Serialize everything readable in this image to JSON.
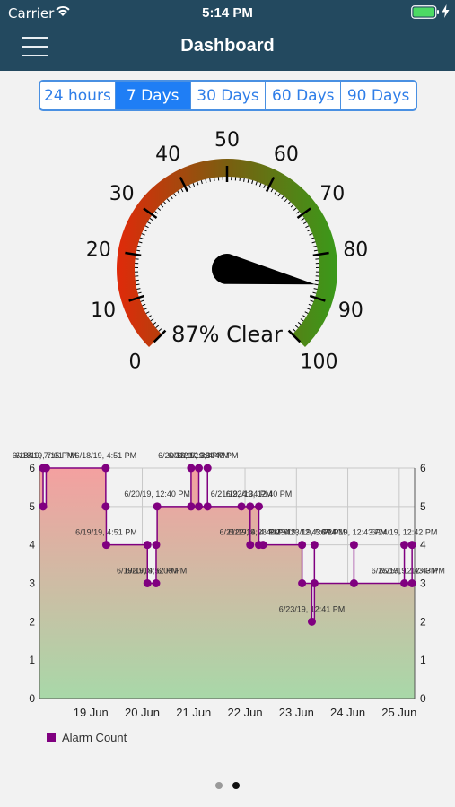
{
  "status_bar": {
    "carrier": "Carrier",
    "time": "5:14 PM"
  },
  "header": {
    "title": "Dashboard"
  },
  "range_tabs": [
    {
      "label": "24 hours",
      "active": false
    },
    {
      "label": "7 Days",
      "active": true
    },
    {
      "label": "30 Days",
      "active": false
    },
    {
      "label": "60 Days",
      "active": false
    },
    {
      "label": "90 Days",
      "active": false
    }
  ],
  "gauge": {
    "value": 87,
    "caption": "87% Clear",
    "min": 0,
    "max": 100,
    "major_labels": [
      "0",
      "10",
      "20",
      "30",
      "40",
      "50",
      "60",
      "70",
      "80",
      "90",
      "100"
    ],
    "gradient": [
      "#e02a0a",
      "#7a5e10",
      "#3a9a1a"
    ]
  },
  "chart_data": {
    "type": "line",
    "xlabels": [
      "19 Jun",
      "20 Jun",
      "21 Jun",
      "22 Jun",
      "23 Jun",
      "24 Jun",
      "25 Jun"
    ],
    "ylim": [
      0,
      6
    ],
    "yticks": [
      "0",
      "1",
      "2",
      "3",
      "4",
      "5",
      "6"
    ],
    "step": true,
    "grid": true,
    "legend": "bottom-left",
    "series": [
      {
        "name": "Alarm Count",
        "color": "#800080",
        "points": [
          {
            "x": 18.07,
            "y": 6
          },
          {
            "x": 18.07,
            "y": 5
          },
          {
            "x": 18.13,
            "y": 6
          },
          {
            "x": 19.29,
            "y": 6
          },
          {
            "x": 19.29,
            "y": 5
          },
          {
            "x": 19.3,
            "y": 4
          },
          {
            "x": 20.1,
            "y": 4
          },
          {
            "x": 20.1,
            "y": 3
          },
          {
            "x": 20.27,
            "y": 3
          },
          {
            "x": 20.27,
            "y": 4
          },
          {
            "x": 20.29,
            "y": 5
          },
          {
            "x": 20.95,
            "y": 5
          },
          {
            "x": 20.95,
            "y": 6
          },
          {
            "x": 21.1,
            "y": 6
          },
          {
            "x": 21.1,
            "y": 5
          },
          {
            "x": 21.27,
            "y": 6
          },
          {
            "x": 21.27,
            "y": 5
          },
          {
            "x": 21.93,
            "y": 5
          },
          {
            "x": 22.1,
            "y": 4
          },
          {
            "x": 22.1,
            "y": 5
          },
          {
            "x": 22.27,
            "y": 5
          },
          {
            "x": 22.27,
            "y": 4
          },
          {
            "x": 22.35,
            "y": 4
          },
          {
            "x": 23.11,
            "y": 4
          },
          {
            "x": 23.11,
            "y": 3
          },
          {
            "x": 23.3,
            "y": 2
          },
          {
            "x": 23.35,
            "y": 4
          },
          {
            "x": 23.35,
            "y": 3
          },
          {
            "x": 24.12,
            "y": 4
          },
          {
            "x": 24.12,
            "y": 3
          },
          {
            "x": 25.1,
            "y": 4
          },
          {
            "x": 25.1,
            "y": 3
          },
          {
            "x": 25.25,
            "y": 4
          },
          {
            "x": 25.25,
            "y": 3
          }
        ]
      }
    ],
    "point_labels": [
      "6/18/19, 7:15 PM",
      "6/18/19, 7:01 PM",
      "6/18/19, 4:51 PM",
      "6/19/19, 4:51 PM",
      "6/19/19, 4:52 PM",
      "6/20/19, 6:00 PM",
      "6/20/19, 12:40 PM",
      "6/20/19, 12:38 PM",
      "6/21/19, 3:30 PM",
      "6/21/19, 4:40 PM",
      "6/21/19, 4:34 PM",
      "6/21/19, 4:26 PM",
      "6/22/19, 12:40 PM",
      "6/22/19, 4:40 PM",
      "6/23/19, 12:43 PM",
      "6/23/19, 12:41 PM",
      "6/23/19, 5:07 PM",
      "6/24/19, 12:43 PM",
      "6/24/19, 12:42 PM",
      "6/25/19, 12:43 PM",
      "6/25/19, 12:43 PM"
    ]
  },
  "chart_legend": {
    "label": "Alarm Count",
    "color": "#800080"
  },
  "page_indicator": {
    "count": 2,
    "active": 1
  }
}
